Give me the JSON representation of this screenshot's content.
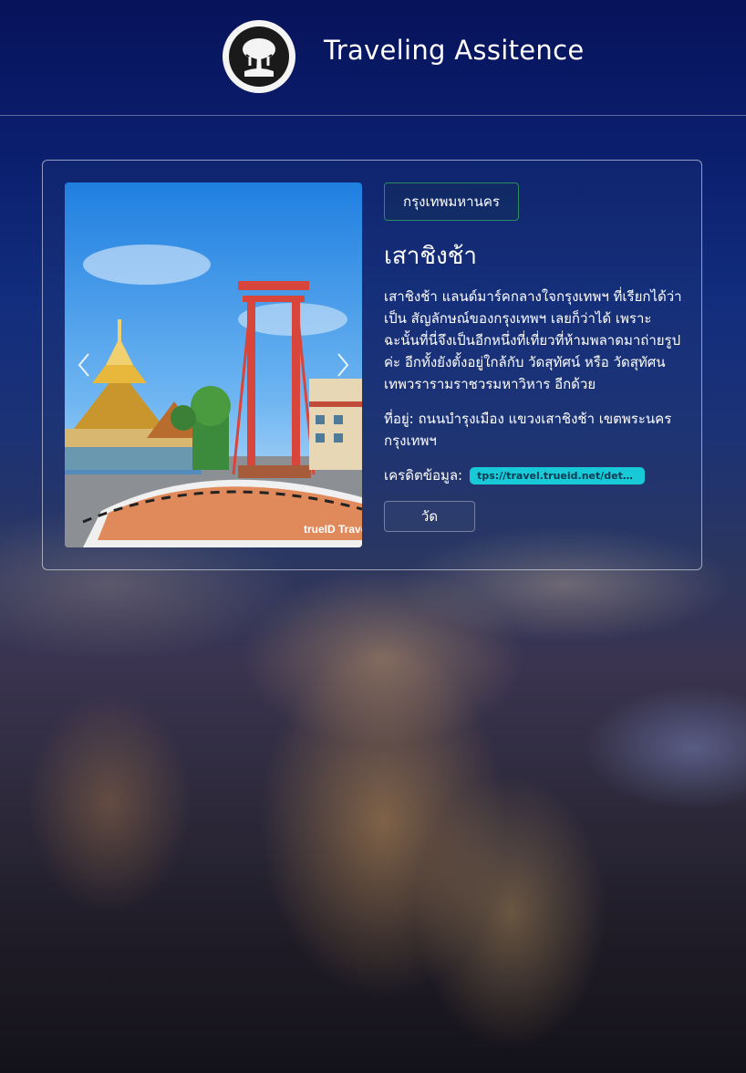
{
  "header": {
    "title": "Traveling Assitence",
    "logo_icon": "tree-logo-icon"
  },
  "place": {
    "province": "กรุงเทพมหานคร",
    "name": "เสาชิงช้า",
    "description": "เสาชิงช้า แลนด์มาร์คกลางใจกรุงเทพฯ ที่เรียกได้ว่าเป็น สัญลักษณ์ของกรุงเทพฯ เลยก็ว่าได้ เพราะฉะนั้นที่นี่จึงเป็นอีกหนึ่งที่เที่ยวที่ห้ามพลาดมาถ่ายรูปค่ะ อีกทั้งยังตั้งอยู่ใกล้กับ วัดสุทัศน์ หรือ วัดสุทัศนเทพวรารามราชวรมหาวิหาร อีกด้วย",
    "address": "ที่อยู่: ถนนบำรุงเมือง แขวงเสาชิงช้า เขตพระนคร กรุงเทพฯ",
    "credit_label": "เครดิตข้อมูล:",
    "credit_link": "tps://travel.trueid.net/detail/pepl...",
    "tag": "วัด",
    "photo_watermark": "trueID Travel"
  },
  "colors": {
    "province_border": "#2c8c5c",
    "credit_bg": "#18c9d8",
    "swing_red": "#d8453a"
  }
}
